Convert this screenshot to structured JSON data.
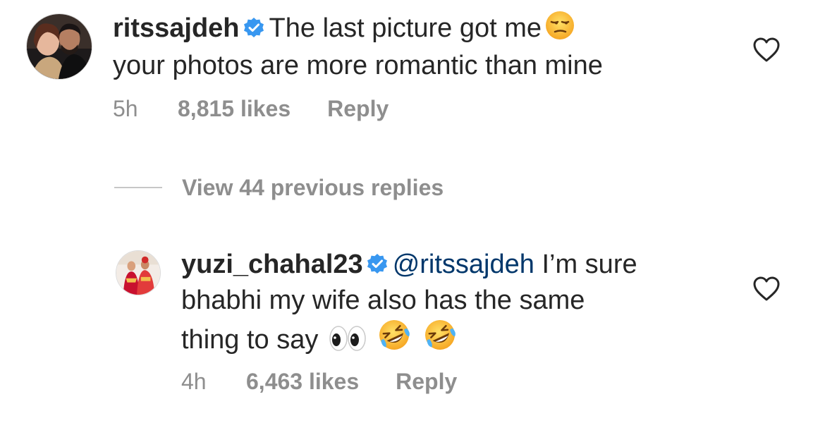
{
  "comments": [
    {
      "username": "ritssajdeh",
      "verified": true,
      "mention": "",
      "line1": "The last picture got me",
      "line2": "your photos are more romantic than mine",
      "emoji": [
        "unamused-face-emoji"
      ],
      "time": "5h",
      "likes": "8,815 likes",
      "reply_label": "Reply",
      "avatar_icon": "couple-photo-avatar",
      "like_icon": "heart-outline-icon"
    },
    {
      "username": "yuzi_chahal23",
      "verified": true,
      "mention": "@ritssajdeh",
      "line1": "I’m sure",
      "line2": "bhabhi my wife also has the same",
      "line3": "thing to say",
      "emoji": [
        "eyes-emoji",
        "rolling-on-floor-laughing-emoji",
        "rolling-on-floor-laughing-emoji"
      ],
      "time": "4h",
      "likes": "6,463 likes",
      "reply_label": "Reply",
      "avatar_icon": "wedding-photo-avatar",
      "like_icon": "heart-outline-icon"
    }
  ],
  "replies_toggle": {
    "label": "View 44 previous replies"
  },
  "colors": {
    "text": "#262626",
    "secondary": "#8e8e8e",
    "mention": "#00376b",
    "verified": "#3897f0"
  }
}
